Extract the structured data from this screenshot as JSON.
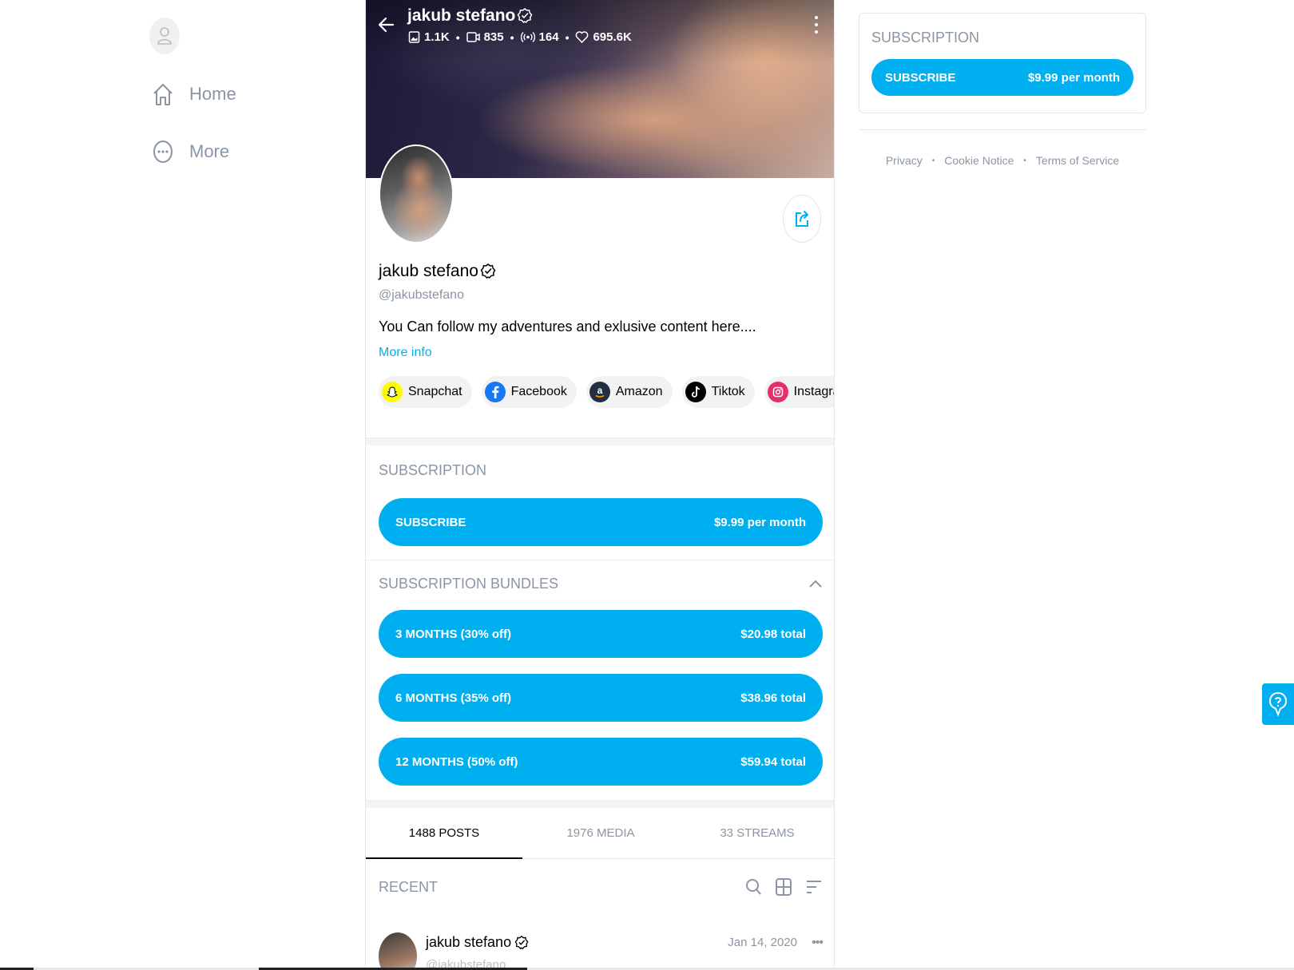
{
  "nav": {
    "home_label": "Home",
    "more_label": "More"
  },
  "profile": {
    "display_name": "jakub stefano",
    "handle": "@jakubstefano",
    "bio": "You Can follow my adventures and exlusive content here....",
    "more_info_label": "More info",
    "stats": {
      "photos": "1.1K",
      "videos": "835",
      "streams": "164",
      "likes": "695.6K"
    },
    "socials": [
      {
        "label": "Snapchat",
        "icon": "snapchat-icon",
        "color": "#fffc00"
      },
      {
        "label": "Facebook",
        "icon": "facebook-icon",
        "color": "#1877f2"
      },
      {
        "label": "Amazon",
        "icon": "amazon-icon",
        "color": "#232f3e"
      },
      {
        "label": "Tiktok",
        "icon": "tiktok-icon",
        "color": "#000000"
      },
      {
        "label": "Instagram",
        "icon": "instagram-icon",
        "color": "#e1306c"
      }
    ]
  },
  "subscription": {
    "title": "SUBSCRIPTION",
    "subscribe_label": "SUBSCRIBE",
    "price_label": "$9.99 per month"
  },
  "bundles": {
    "title": "SUBSCRIPTION BUNDLES",
    "items": [
      {
        "label": "3 MONTHS (30% off)",
        "price": "$20.98 total"
      },
      {
        "label": "6 MONTHS (35% off)",
        "price": "$38.96 total"
      },
      {
        "label": "12 MONTHS (50% off)",
        "price": "$59.94 total"
      }
    ]
  },
  "tabs": [
    {
      "label": "1488 POSTS",
      "active": true
    },
    {
      "label": "1976 MEDIA",
      "active": false
    },
    {
      "label": "33 STREAMS",
      "active": false
    }
  ],
  "feed": {
    "recent_label": "RECENT",
    "post": {
      "author": "jakub stefano",
      "handle": "@jakubstefano",
      "date": "Jan 14, 2020",
      "more": "•••"
    }
  },
  "sidebar_right": {
    "title": "SUBSCRIPTION",
    "subscribe_label": "SUBSCRIBE",
    "price_label": "$9.99 per month"
  },
  "footer": {
    "privacy": "Privacy",
    "cookie": "Cookie Notice",
    "terms": "Terms of Service",
    "sep": "•"
  },
  "colors": {
    "accent": "#00aff0",
    "muted": "#8a96a3"
  }
}
